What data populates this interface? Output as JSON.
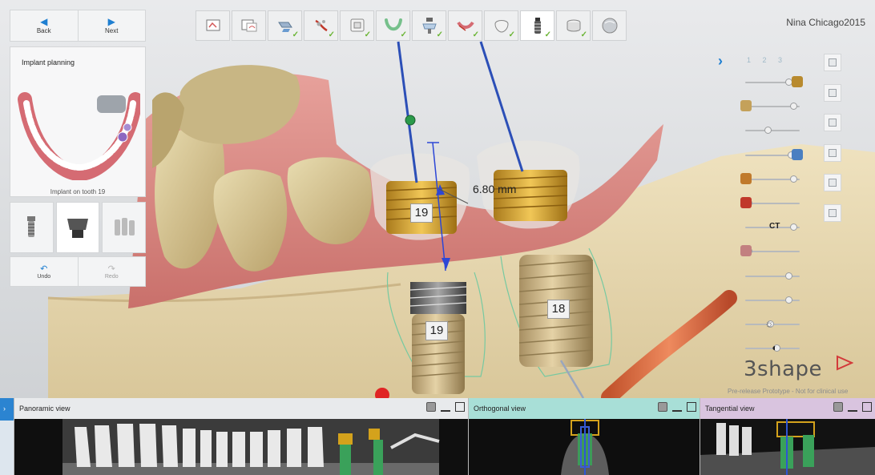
{
  "nav": {
    "back_label": "Back",
    "next_label": "Next"
  },
  "workflow": {
    "steps": [
      {
        "icon": "patient-data-icon",
        "completed": false
      },
      {
        "icon": "scan-import-icon",
        "completed": false
      },
      {
        "icon": "align-data-icon",
        "completed": true
      },
      {
        "icon": "nerve-tool-icon",
        "completed": true
      },
      {
        "icon": "crown-frame-icon",
        "completed": true
      },
      {
        "icon": "arch-curve-icon",
        "completed": true
      },
      {
        "icon": "implant-add-icon",
        "completed": true
      },
      {
        "icon": "jaw-segment-icon",
        "completed": true
      },
      {
        "icon": "tooth-shape-icon",
        "completed": true
      },
      {
        "icon": "implant-icon",
        "completed": true,
        "current": true
      },
      {
        "icon": "sleeve-icon",
        "completed": true
      },
      {
        "icon": "sphere-render-icon",
        "completed": false
      }
    ]
  },
  "user": {
    "name": "Nina Chicago2015"
  },
  "plan_panel": {
    "title": "Implant planning",
    "caption": "Implant on tooth 19",
    "undo_label": "Undo",
    "redo_label": "Redo"
  },
  "tools": [
    {
      "icon": "implant-screw-icon"
    },
    {
      "icon": "abutment-icon"
    },
    {
      "icon": "multi-implant-icon"
    }
  ],
  "scene": {
    "implant_labels": [
      "19",
      "19",
      "18"
    ],
    "measurement": "6.80 mm",
    "tab_marks": "1 2 3"
  },
  "right_panel": {
    "ct_label": "CT",
    "sliders": [
      {
        "icon": "crown-opacity-icon",
        "level": 0.85,
        "icon_side": "right"
      },
      {
        "icon": "scan-opacity-icon",
        "level": 0.95,
        "icon_side": "left"
      },
      {
        "icon": "tooth-opacity-icon",
        "level": 0.4,
        "icon_side": "none"
      },
      {
        "icon": "implant-opacity-icon",
        "level": 0.9,
        "icon_side": "right"
      },
      {
        "icon": "abutment-opacity-icon",
        "level": 0.95,
        "icon_side": "left"
      },
      {
        "icon": "nerve-opacity-icon",
        "level": 0.0,
        "icon_side": "left"
      },
      {
        "icon": "ct-opacity-icon",
        "level": 0.95,
        "icon_side": "text"
      },
      {
        "icon": "bone-opacity-icon",
        "level": 0.0,
        "icon_side": "left"
      },
      {
        "icon": "sleeve-opacity-icon",
        "level": 0.85,
        "icon_side": "none"
      },
      {
        "icon": "gum-opacity-icon",
        "level": 0.85,
        "icon_side": "none"
      },
      {
        "icon": "brightness-icon",
        "level": 0.45,
        "icon_side": "none"
      },
      {
        "icon": "contrast-icon",
        "level": 0.6,
        "icon_side": "none"
      }
    ],
    "view_buttons": [
      "view-front-icon",
      "view-back-icon",
      "view-left-icon",
      "view-right-icon",
      "view-top-icon",
      "view-bottom-icon"
    ]
  },
  "branding": {
    "logo": "3shape",
    "disclaimer": "Pre-release Prototype - Not for clinical use"
  },
  "bottom_views": {
    "panoramic_label": "Panoramic view",
    "orthogonal_label": "Orthogonal view",
    "tangential_label": "Tangential view"
  },
  "colors": {
    "accent_blue": "#1f7fd1",
    "check_green": "#6bb535",
    "orthogonal_header": "#a8dfd7",
    "tangential_header": "#d9c4df"
  }
}
